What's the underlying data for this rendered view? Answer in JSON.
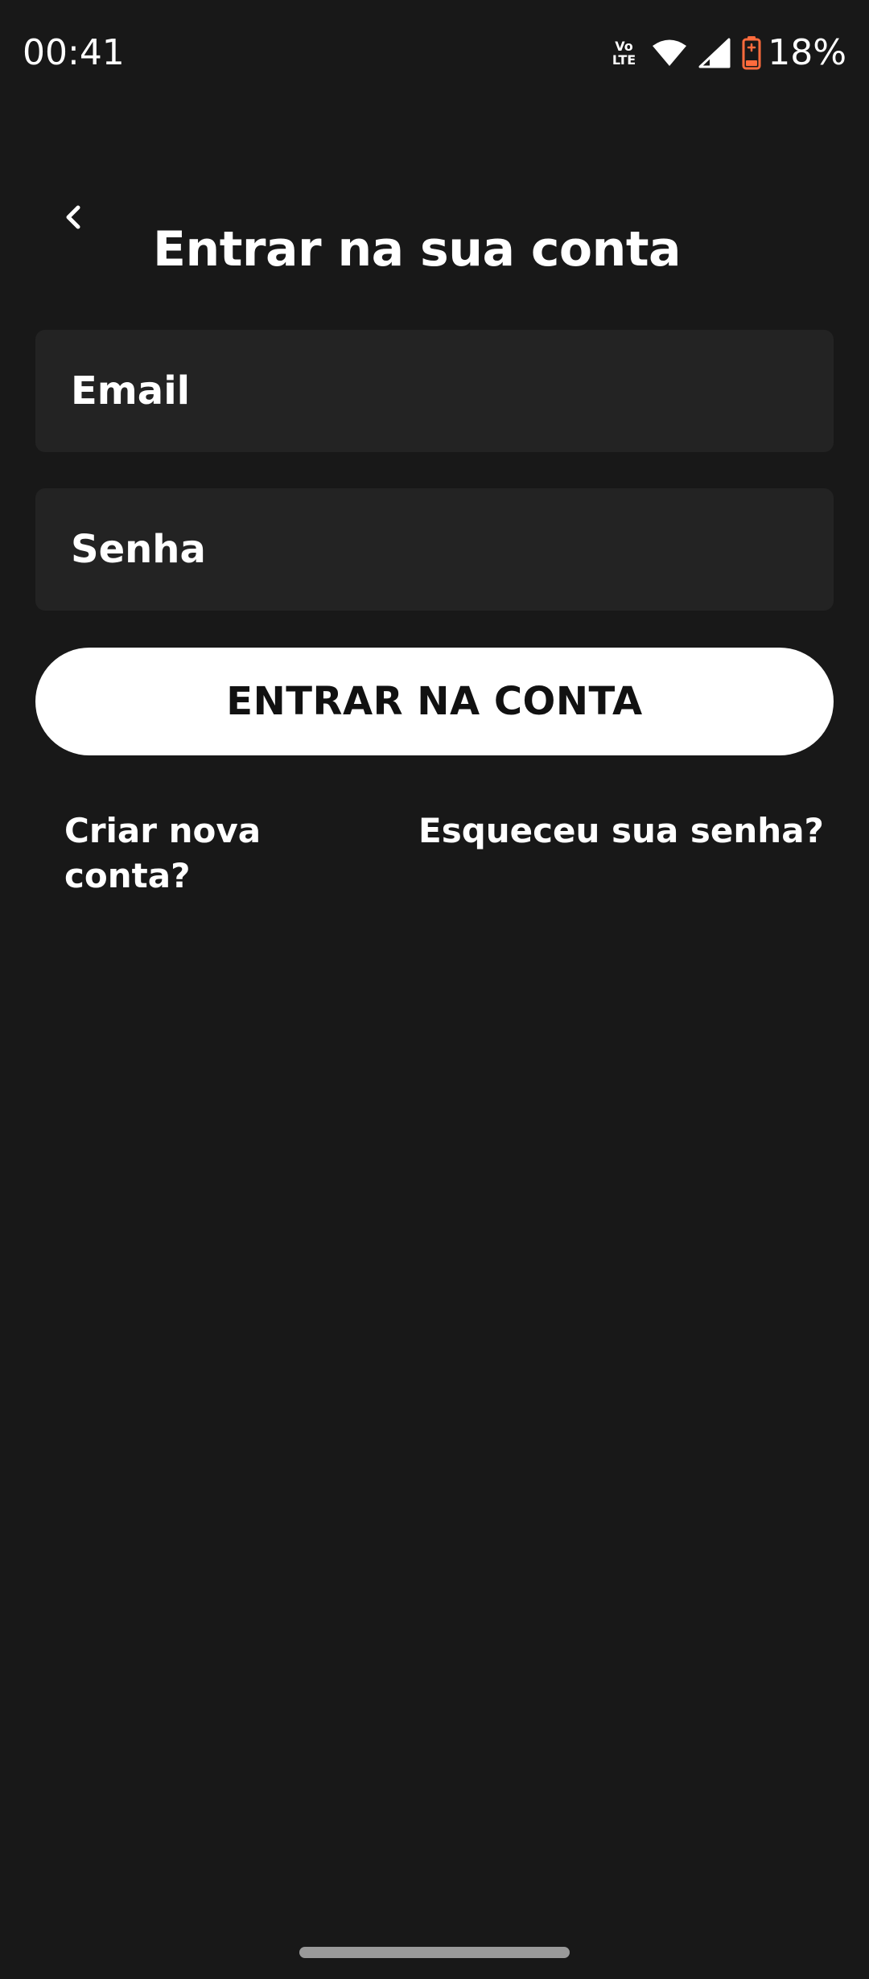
{
  "status_bar": {
    "time": "00:41",
    "volte_top": "Vo",
    "volte_bottom": "LTE",
    "battery_percent": "18%",
    "battery_color": "#ff6b3d"
  },
  "header": {
    "back_icon": "chevron-left-icon",
    "title": "Entrar na sua conta"
  },
  "form": {
    "email_placeholder": "Email",
    "email_value": "",
    "password_placeholder": "Senha",
    "password_value": "",
    "submit_label": "ENTRAR NA CONTA"
  },
  "links": {
    "create_account": "Criar nova conta?",
    "forgot_password": "Esqueceu sua senha?"
  },
  "colors": {
    "background": "#181818",
    "field_background": "#232323",
    "button_background": "#ffffff",
    "button_text": "#111111"
  }
}
